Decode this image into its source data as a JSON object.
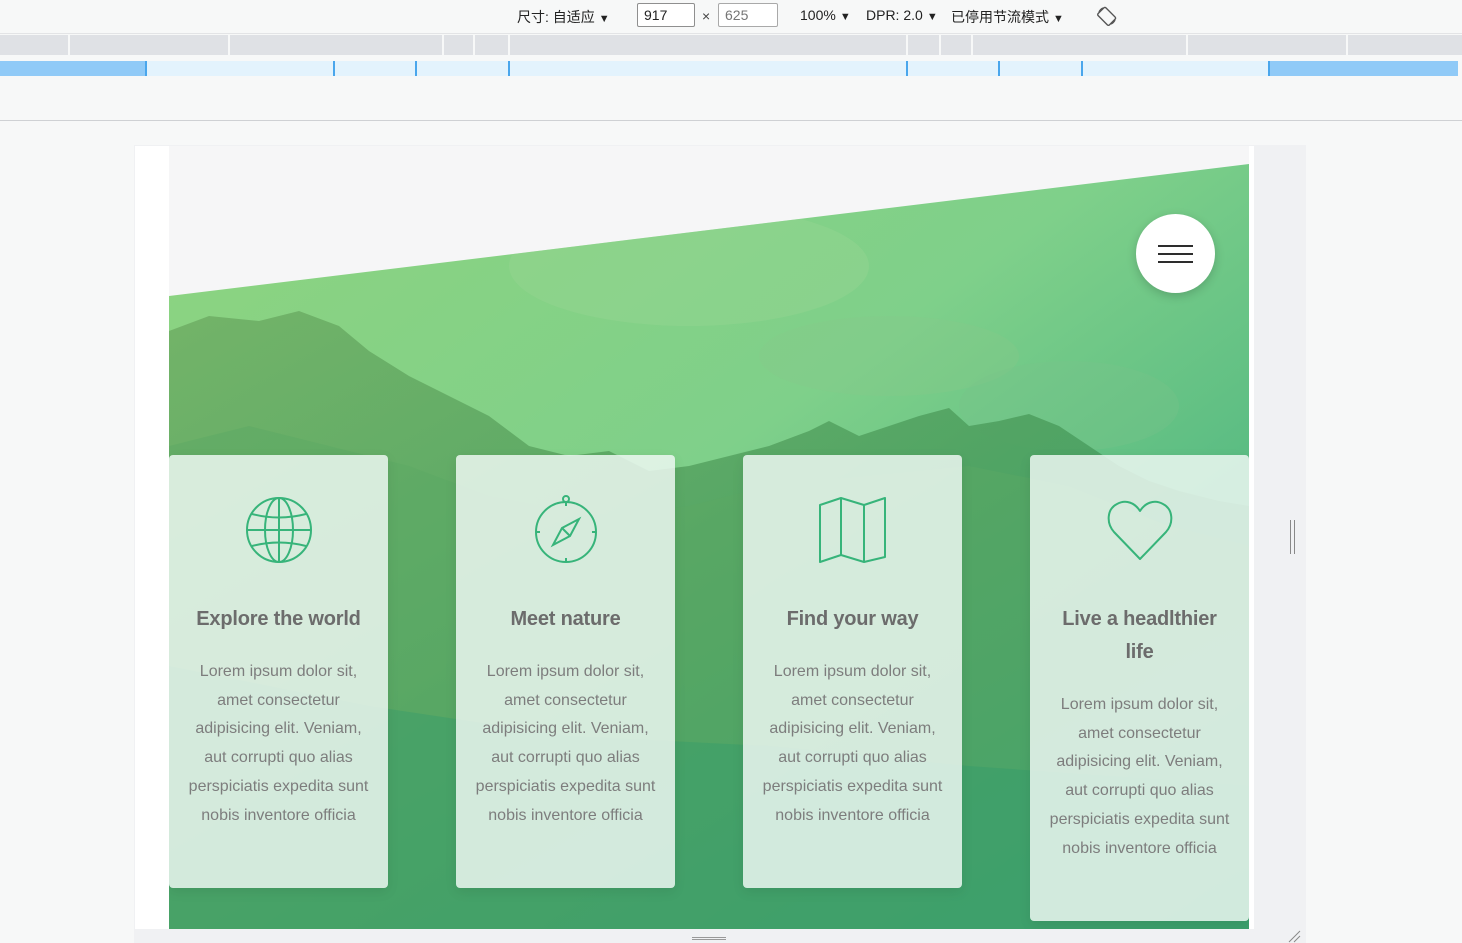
{
  "devtools": {
    "size_label": "尺寸: 自适应",
    "width_value": "917",
    "height_placeholder": "625",
    "times": "×",
    "zoom": "100%",
    "dpr": "DPR: 2.0",
    "throttle": "已停用节流模式",
    "arrow": "▼",
    "rotate_icon": "rotate-icon"
  },
  "page": {
    "menu_icon": "hamburger-icon",
    "accent_color": "#37b47a",
    "cards": [
      {
        "icon": "globe-icon",
        "title": "Explore the world",
        "text": "Lorem ipsum dolor sit, amet consectetur adipisicing elit. Veniam, aut corrupti quo alias perspiciatis expedita sunt nobis inventore officia"
      },
      {
        "icon": "compass-icon",
        "title": "Meet nature",
        "text": "Lorem ipsum dolor sit, amet consectetur adipisicing elit. Veniam, aut corrupti quo alias perspiciatis expedita sunt nobis inventore officia"
      },
      {
        "icon": "map-icon",
        "title": "Find your way",
        "text": "Lorem ipsum dolor sit, amet consectetur adipisicing elit. Veniam, aut corrupti quo alias perspiciatis expedita sunt nobis inventore officia"
      },
      {
        "icon": "heart-icon",
        "title": "Live a headlthier life",
        "text": "Lorem ipsum dolor sit, amet consectetur adipisicing elit. Veniam, aut corrupti quo alias perspiciatis expedita sunt nobis inventore officia"
      }
    ]
  }
}
